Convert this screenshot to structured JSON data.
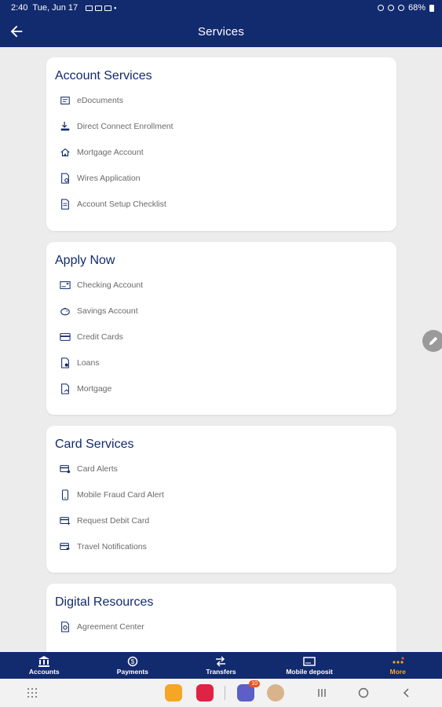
{
  "status_bar": {
    "time": "2:40",
    "date": "Tue, Jun 17",
    "battery": "68%"
  },
  "header": {
    "title": "Services",
    "back_icon": "arrow-left-icon"
  },
  "sections": [
    {
      "title": "Account Services",
      "items": [
        {
          "label": "eDocuments",
          "icon": "document-list-icon"
        },
        {
          "label": "Direct Connect Enrollment",
          "icon": "download-monitor-icon"
        },
        {
          "label": "Mortgage Account",
          "icon": "home-icon"
        },
        {
          "label": "Wires Application",
          "icon": "document-gear-icon"
        },
        {
          "label": "Account Setup Checklist",
          "icon": "checklist-icon"
        }
      ]
    },
    {
      "title": "Apply Now",
      "items": [
        {
          "label": "Checking Account",
          "icon": "check-icon"
        },
        {
          "label": "Savings Account",
          "icon": "piggy-bank-icon"
        },
        {
          "label": "Credit Cards",
          "icon": "credit-card-icon"
        },
        {
          "label": "Loans",
          "icon": "document-dollar-icon"
        },
        {
          "label": "Mortgage",
          "icon": "document-home-icon"
        }
      ]
    },
    {
      "title": "Card Services",
      "items": [
        {
          "label": "Card Alerts",
          "icon": "card-alert-icon"
        },
        {
          "label": "Mobile Fraud Card Alert",
          "icon": "phone-alert-icon"
        },
        {
          "label": "Request Debit Card",
          "icon": "card-add-icon"
        },
        {
          "label": "Travel Notifications",
          "icon": "card-plane-icon"
        }
      ]
    },
    {
      "title": "Digital Resources",
      "items": [
        {
          "label": "Agreement Center",
          "icon": "document-check-icon"
        }
      ]
    }
  ],
  "bottom_nav": [
    {
      "label": "Accounts",
      "icon": "bank-icon"
    },
    {
      "label": "Payments",
      "icon": "payment-cycle-icon"
    },
    {
      "label": "Transfers",
      "icon": "transfer-arrows-icon"
    },
    {
      "label": "Mobile deposit",
      "icon": "check-scan-icon"
    },
    {
      "label": "More",
      "icon": "more-dots-icon"
    }
  ],
  "system_nav": {
    "teams_badge": "10"
  },
  "colors": {
    "primary": "#122a6e",
    "active": "#f5a623",
    "background": "#ececec"
  }
}
